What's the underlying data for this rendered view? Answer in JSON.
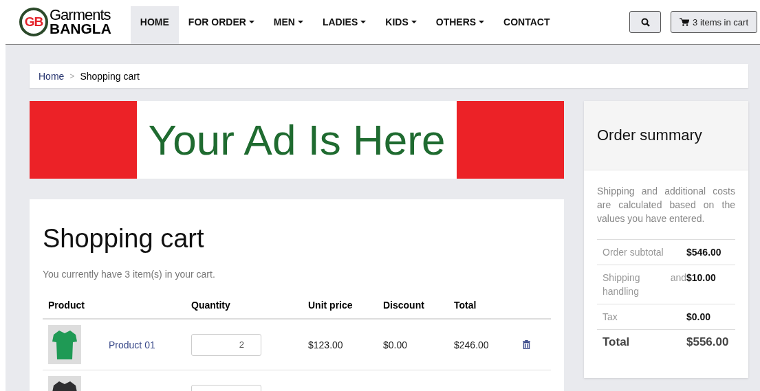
{
  "logo": {
    "mark": "GB",
    "line_1": "Garments",
    "line_2": "BANGLA"
  },
  "nav": [
    {
      "label": "HOME",
      "selected": true,
      "dropdown": false
    },
    {
      "label": "FOR ORDER",
      "selected": false,
      "dropdown": true
    },
    {
      "label": "MEN",
      "selected": false,
      "dropdown": true
    },
    {
      "label": "LADIES",
      "selected": false,
      "dropdown": true
    },
    {
      "label": "KIDS",
      "selected": false,
      "dropdown": true
    },
    {
      "label": "OTHERS",
      "selected": false,
      "dropdown": true
    },
    {
      "label": "CONTACT",
      "selected": false,
      "dropdown": false
    }
  ],
  "cart_button": {
    "label": "3 items in cart"
  },
  "breadcrumb": {
    "items": [
      "Home",
      "Shopping cart"
    ],
    "separator": ">"
  },
  "ad": {
    "text": "Your Ad Is Here"
  },
  "cart": {
    "title": "Shopping cart",
    "subtitle": "You currently have 3 item(s) in your cart.",
    "columns": [
      "Product",
      "Quantity",
      "Unit price",
      "Discount",
      "Total"
    ],
    "rows": [
      {
        "name": "Product 01",
        "quantity": "2",
        "unit_price": "$123.00",
        "discount": "$0.00",
        "total": "$246.00",
        "color": "#1f9a55"
      },
      {
        "color": "#2e2e30"
      }
    ]
  },
  "summary": {
    "title": "Order summary",
    "note": "Shipping and additional costs are calculated based on the values you have entered.",
    "lines": [
      {
        "label": "Order subtotal",
        "value": "$546.00",
        "kind": "line"
      },
      {
        "label": "Shipping and handling",
        "value": "$10.00",
        "kind": "line"
      },
      {
        "label": "Tax",
        "value": "$0.00",
        "kind": "line"
      },
      {
        "label": "Total",
        "value": "$556.00",
        "kind": "total"
      }
    ]
  }
}
